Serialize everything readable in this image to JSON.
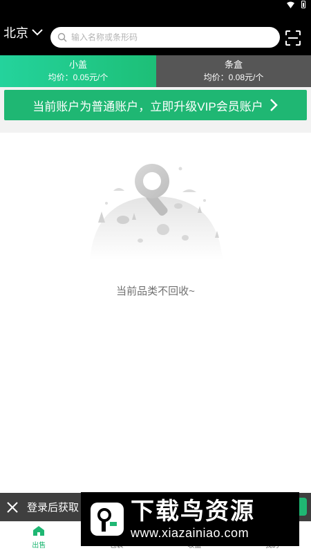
{
  "header": {
    "city": "北京",
    "search_placeholder": "输入名称或条形码"
  },
  "tabs": [
    {
      "name": "小盖",
      "price": "均价：0.05元/个",
      "active": true
    },
    {
      "name": "条盒",
      "price": "均价：0.08元/个",
      "active": false
    }
  ],
  "vip_banner": {
    "text": "当前账户为普通账户，立即升级VIP会员账户"
  },
  "empty_state": {
    "text": "当前品类不回收~"
  },
  "login_bar": {
    "text": "登录后获取"
  },
  "bottom_nav": [
    {
      "label": "出售",
      "icon": "home-icon",
      "active": true
    },
    {
      "label": "包裹",
      "icon": "package-icon",
      "active": false
    },
    {
      "label": "收益",
      "icon": "earnings-icon",
      "active": false
    },
    {
      "label": "我的",
      "icon": "user-icon",
      "active": false
    }
  ],
  "watermark": {
    "title": "下载鸟资源",
    "url": "www.xiazainiao.com"
  },
  "colors": {
    "accent_green": "#1fb773",
    "header_bg": "#000000",
    "inactive_tab": "#565656"
  }
}
